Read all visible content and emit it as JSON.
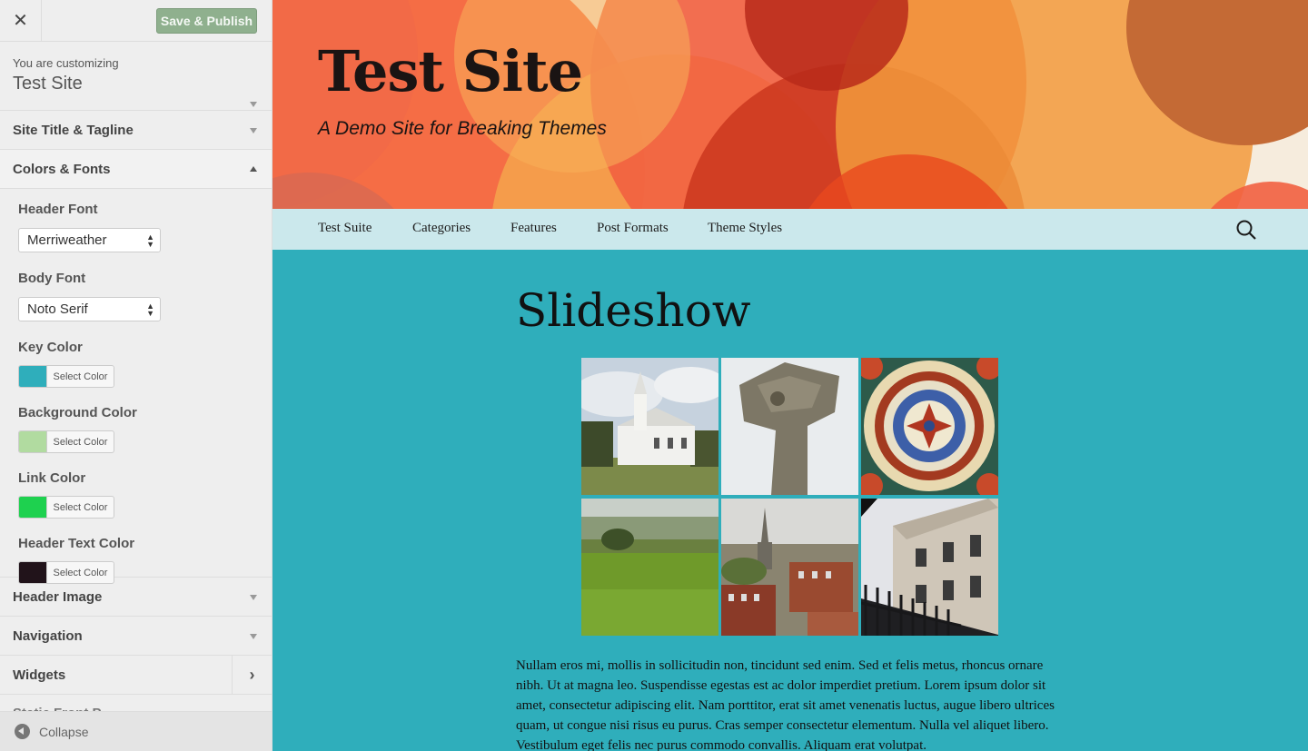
{
  "sidebar": {
    "close_icon": "close-icon",
    "save_label": "Save & Publish",
    "customizing_label": "You are customizing",
    "site_name": "Test Site",
    "sections": {
      "site_title_tagline": "Site Title & Tagline",
      "colors_fonts": "Colors & Fonts",
      "header_image": "Header Image",
      "navigation": "Navigation",
      "widgets": "Widgets",
      "static_front_page": "Static Front P..."
    },
    "controls": {
      "header_font_label": "Header Font",
      "header_font_value": "Merriweather",
      "body_font_label": "Body Font",
      "body_font_value": "Noto Serif",
      "select_color_label": "Select Color",
      "colors": [
        {
          "label": "Key Color",
          "color": "#2faebb"
        },
        {
          "label": "Background Color",
          "color": "#b1dba0"
        },
        {
          "label": "Link Color",
          "color": "#1ed14f"
        },
        {
          "label": "Header Text Color",
          "color": "#21131a"
        }
      ]
    },
    "collapse_label": "Collapse"
  },
  "preview": {
    "site_title": "Test Site",
    "tagline": "A Demo Site for Breaking Themes",
    "nav": [
      "Test Suite",
      "Categories",
      "Features",
      "Post Formats",
      "Theme Styles"
    ],
    "post_title": "Slideshow",
    "gallery_items": [
      "church",
      "stone-cross",
      "mosaic-tile",
      "green-field",
      "town-view",
      "building-with-railing"
    ],
    "post_body": "Nullam eros mi, mollis in sollicitudin non, tincidunt sed enim. Sed et felis metus, rhoncus ornare nibh. Ut at magna leo. Suspendisse egestas est ac dolor imperdiet pretium. Lorem ipsum dolor sit amet, consectetur adipiscing elit. Nam porttitor, erat sit amet venenatis luctus, augue libero ultrices quam, ut congue nisi risus eu purus. Cras semper consectetur elementum. Nulla vel aliquet libero. Vestibulum eget felis nec purus commodo convallis. Aliquam erat volutpat."
  }
}
